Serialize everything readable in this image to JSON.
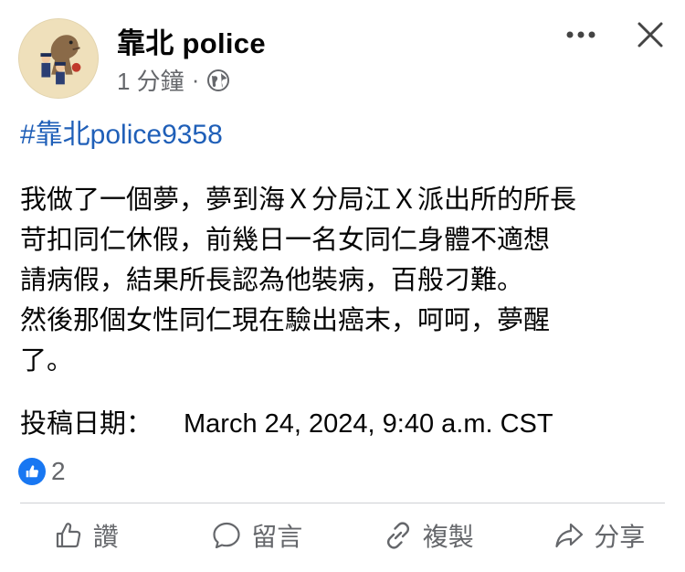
{
  "header": {
    "page_name": "靠北 police",
    "timestamp": "1 分鐘",
    "separator": "·",
    "privacy_icon": "globe-icon",
    "more_icon": "more-horizontal-icon",
    "close_icon": "close-icon"
  },
  "post": {
    "hashtag": "#靠北police9358",
    "body_lines": [
      "我做了一個夢，夢到海Ｘ分局江Ｘ派出所的所長",
      "苛扣同仁休假，前幾日一名女同仁身體不適想",
      "請病假，結果所長認為他裝病，百般刁難。",
      "然後那個女性同仁現在驗出癌末，呵呵，夢醒",
      "了。"
    ],
    "date_label": "投稿日期：",
    "date_value": "March 24, 2024, 9:40 a.m. CST"
  },
  "reactions": {
    "icon": "thumbs-up-icon",
    "count": "2"
  },
  "actions": [
    {
      "label": "讚",
      "icon": "thumbs-up-icon"
    },
    {
      "label": "留言",
      "icon": "comment-icon"
    },
    {
      "label": "複製",
      "icon": "link-icon"
    },
    {
      "label": "分享",
      "icon": "share-icon"
    }
  ],
  "colors": {
    "link": "#1f5fb8",
    "like_blue": "#1877f2",
    "secondary_text": "#65676b"
  }
}
